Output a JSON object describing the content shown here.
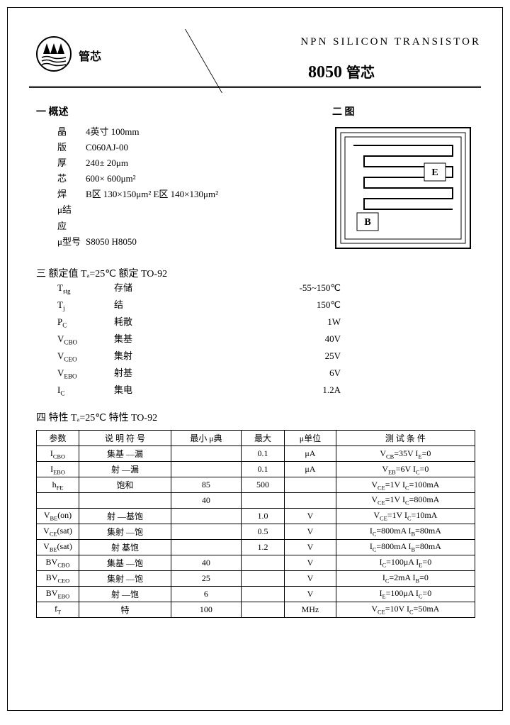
{
  "header": {
    "logo_text": "管芯",
    "title": "NPN   SILICON   TRANSISTOR",
    "part_number": "8050",
    "part_suffix": "管芯"
  },
  "sections": {
    "spec_head": "一  概述",
    "diagram_head": "二  图"
  },
  "specs": [
    {
      "label": "晶",
      "value": "4英寸     100mm"
    },
    {
      "label": "版",
      "value": "C060AJ-00"
    },
    {
      "label": "厚",
      "value": "240± 20μm"
    },
    {
      "label": "芯",
      "value": "600× 600μm²"
    },
    {
      "label": "焊",
      "value": "B区 130×150μm²   E区 140×130μm²"
    },
    {
      "label": "μ结",
      "value": ""
    },
    {
      "label": "应",
      "value": ""
    },
    {
      "label": "μ型号",
      "value": "S8050   H8050"
    }
  ],
  "die_labels": {
    "e": "E",
    "b": "B"
  },
  "ratings_header": "三  额定值   Tₐ=25℃  额定   TO-92",
  "ratings": [
    {
      "param": "Tstg",
      "sub": "stg",
      "prefix": "T",
      "desc": "存储",
      "value": "-55~150℃"
    },
    {
      "param": "Tj",
      "sub": "j",
      "prefix": "T",
      "desc": "结",
      "value": "150℃"
    },
    {
      "param": "PC",
      "sub": "C",
      "prefix": "P",
      "desc": "耗散",
      "value": "1W"
    },
    {
      "param": "VCBO",
      "sub": "CBO",
      "prefix": "V",
      "desc": "集基",
      "value": "40V"
    },
    {
      "param": "VCEO",
      "sub": "CEO",
      "prefix": "V",
      "desc": "集射",
      "value": "25V"
    },
    {
      "param": "VEBO",
      "sub": "EBO",
      "prefix": "V",
      "desc": "射基",
      "value": "6V"
    },
    {
      "param": "IC",
      "sub": "C",
      "prefix": "I",
      "desc": "集电",
      "value": "1.2A"
    }
  ],
  "char_header": "四  特性   Tₐ=25℃  特性   TO-92",
  "char_cols": [
    "参数",
    "说  明   符  号",
    "最小  μ典",
    "最大",
    "μ单位",
    "测  试  条  件"
  ],
  "chars": [
    {
      "param": "I",
      "sub": "CBO",
      "desc": "集基  —漏",
      "min": "",
      "max": "0.1",
      "unit": "μA",
      "cond": "V<sub>CB</sub>=35V  I<sub>E</sub>=0"
    },
    {
      "param": "I",
      "sub": "EBO",
      "desc": "射  —漏",
      "min": "",
      "max": "0.1",
      "unit": "μA",
      "cond": "V<sub>EB</sub>=6V  I<sub>C</sub>=0"
    },
    {
      "param": "h",
      "sub": "FE",
      "desc": "饱和",
      "min": "85",
      "max": "500",
      "unit": "",
      "cond": "V<sub>CE</sub>=1V  I<sub>C</sub>=100mA"
    },
    {
      "param": "",
      "sub": "",
      "desc": "",
      "min": "40",
      "max": "",
      "unit": "",
      "cond": "V<sub>CE</sub>=1V  I<sub>C</sub>=800mA"
    },
    {
      "param": "V",
      "sub": "BE",
      "suffix": "(on)",
      "desc": "射  —基饱",
      "min": "",
      "max": "1.0",
      "unit": "V",
      "cond": "V<sub>CE</sub>=1V  I<sub>C</sub>=10mA"
    },
    {
      "param": "V",
      "sub": "CE",
      "suffix": "(sat)",
      "desc": "集射  —饱",
      "min": "",
      "max": "0.5",
      "unit": "V",
      "cond": "I<sub>C</sub>=800mA  I<sub>B</sub>=80mA"
    },
    {
      "param": "V",
      "sub": "BE",
      "suffix": "(sat)",
      "desc": "射  基饱",
      "min": "",
      "max": "1.2",
      "unit": "V",
      "cond": "I<sub>C</sub>=800mA  I<sub>B</sub>=80mA"
    },
    {
      "param": "BV",
      "sub": "CBO",
      "desc": "集基  —饱",
      "min": "40",
      "max": "",
      "unit": "V",
      "cond": "I<sub>C</sub>=100μA  I<sub>E</sub>=0"
    },
    {
      "param": "BV",
      "sub": "CEO",
      "desc": "集射  —饱",
      "min": "25",
      "max": "",
      "unit": "V",
      "cond": "I<sub>C</sub>=2mA  I<sub>B</sub>=0"
    },
    {
      "param": "BV",
      "sub": "EBO",
      "desc": "射  —饱",
      "min": "6",
      "max": "",
      "unit": "V",
      "cond": "I<sub>E</sub>=100μA  I<sub>C</sub>=0"
    },
    {
      "param": "f",
      "sub": "T",
      "desc": "特",
      "min": "100",
      "max": "",
      "unit": "MHz",
      "cond": "V<sub>CE</sub>=10V  I<sub>C</sub>=50mA"
    }
  ]
}
